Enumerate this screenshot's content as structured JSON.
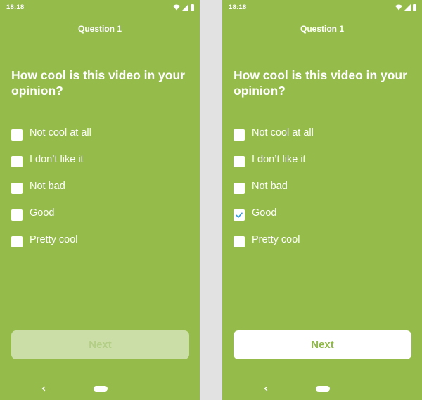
{
  "colors": {
    "screen_background": "#95bc4b",
    "divider_background": "#e2e2e2",
    "text": "#ffffff",
    "checkmark": "#2e9be0",
    "next_disabled_background": "#cbdea8",
    "next_disabled_text": "#b3cf85",
    "next_enabled_background": "#ffffff",
    "next_enabled_text": "#90b848"
  },
  "screens": [
    {
      "status_bar": {
        "time": "18:18",
        "icons": [
          "wifi-icon",
          "signal-icon",
          "battery-icon"
        ]
      },
      "title": "Question 1",
      "question": "How cool is this video in your opinion?",
      "options": [
        {
          "label": "Not cool at all",
          "checked": false
        },
        {
          "label": "I don’t like it",
          "checked": false
        },
        {
          "label": "Not bad",
          "checked": false
        },
        {
          "label": "Good",
          "checked": false
        },
        {
          "label": "Pretty cool",
          "checked": false
        }
      ],
      "next_button": {
        "label": "Next",
        "enabled": false
      },
      "nav_bar": {
        "icons": [
          "back-icon",
          "home-pill-icon"
        ]
      }
    },
    {
      "status_bar": {
        "time": "18:18",
        "icons": [
          "wifi-icon",
          "signal-icon",
          "battery-icon"
        ]
      },
      "title": "Question 1",
      "question": "How cool is this video in your opinion?",
      "options": [
        {
          "label": "Not cool at all",
          "checked": false
        },
        {
          "label": "I don’t like it",
          "checked": false
        },
        {
          "label": "Not bad",
          "checked": false
        },
        {
          "label": "Good",
          "checked": true
        },
        {
          "label": "Pretty cool",
          "checked": false
        }
      ],
      "next_button": {
        "label": "Next",
        "enabled": true
      },
      "nav_bar": {
        "icons": [
          "back-icon",
          "home-pill-icon"
        ]
      }
    }
  ]
}
